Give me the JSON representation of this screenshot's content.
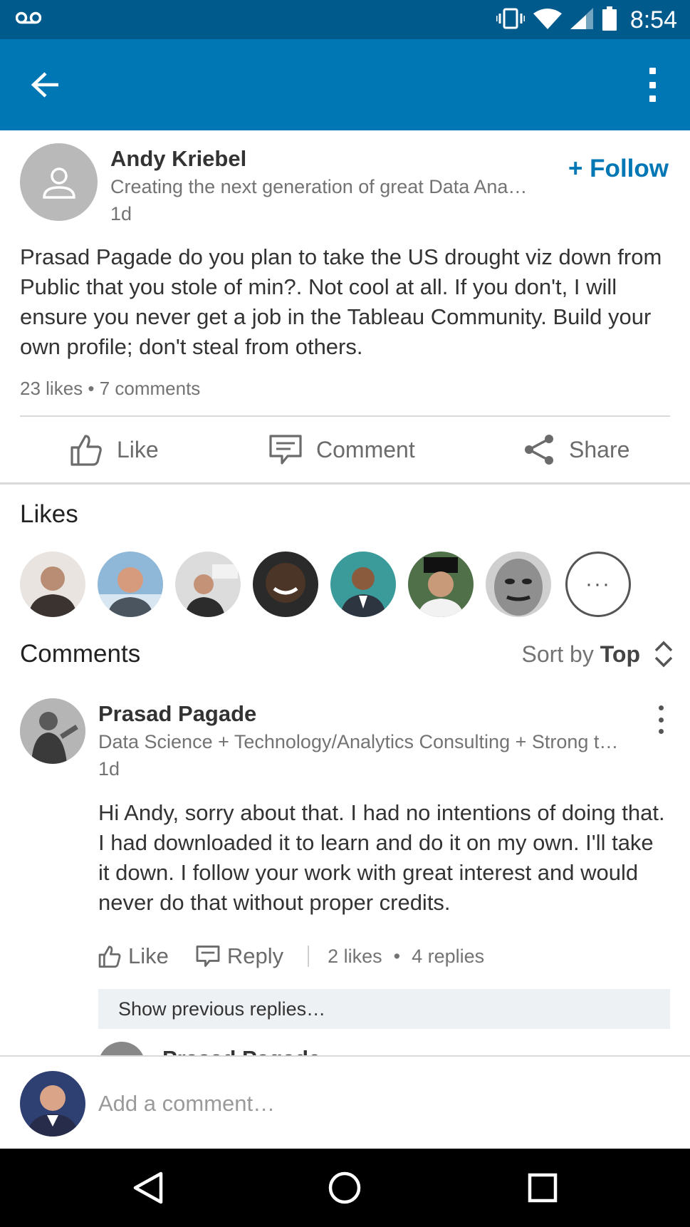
{
  "status_bar": {
    "time": "8:54"
  },
  "app_bar": {},
  "post": {
    "author": "Andy Kriebel",
    "headline": "Creating the next generation of great Data Ana…",
    "time": "1d",
    "follow_label": "+ Follow",
    "text": "Prasad Pagade do you plan to take the US drought viz down from Public that you stole of min?. Not cool at all. If you don't, I will ensure you never get a job in the Tableau Community. Build your own profile; don't steal from others.",
    "counts": "23 likes • 7 comments",
    "actions": {
      "like": "Like",
      "comment": "Comment",
      "share": "Share"
    }
  },
  "likes": {
    "title": "Likes",
    "more_label": "···",
    "avatar_colors": [
      "#8a6b5a",
      "#6f8fae",
      "#c8c8c8",
      "#2b2b2b",
      "#3c8c8c",
      "#2f4a2a",
      "#3a3a3a"
    ]
  },
  "comments": {
    "title": "Comments",
    "sort_prefix": "Sort by ",
    "sort_value": "Top",
    "items": [
      {
        "author": "Prasad Pagade",
        "headline": "Data Science + Technology/Analytics Consulting + Strong t…",
        "time": "1d",
        "text": "Hi Andy, sorry about that. I had no intentions of doing that. I had downloaded it to learn and do it on my own. I'll take it down. I follow your work with great interest and would never do that without proper credits.",
        "like_label": "Like",
        "reply_label": "Reply",
        "likes": "2 likes",
        "replies": "4 replies",
        "show_previous": "Show previous replies…",
        "next_reply_author": "Prasad Pagade"
      }
    ]
  },
  "composer": {
    "placeholder": "Add a comment…"
  },
  "colors": {
    "brand": "#0077b5",
    "status_bar": "#005a8c"
  }
}
